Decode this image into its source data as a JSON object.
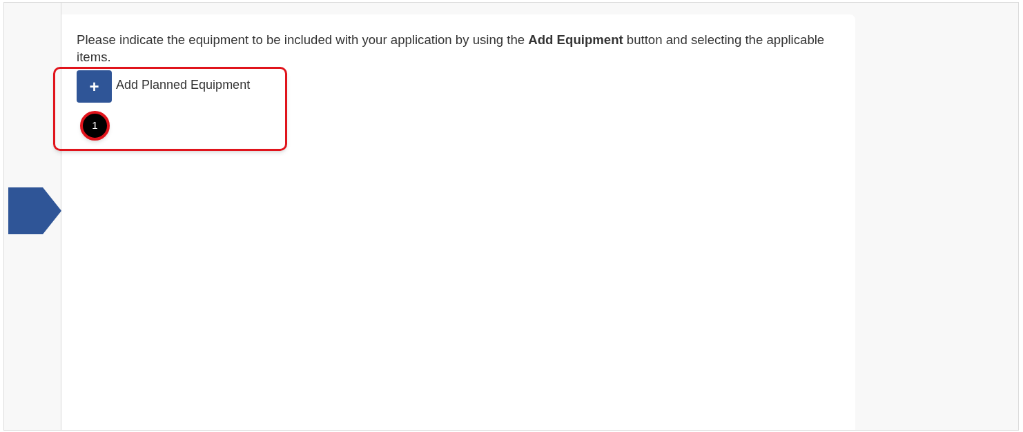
{
  "instructions": "Please indicate the equipment to be included with your application by using the **Add Equipment** button and selecting the applicable items.",
  "add_button": {
    "icon": "+",
    "label": "Add Planned Equipment"
  },
  "callout": {
    "number": "1"
  }
}
